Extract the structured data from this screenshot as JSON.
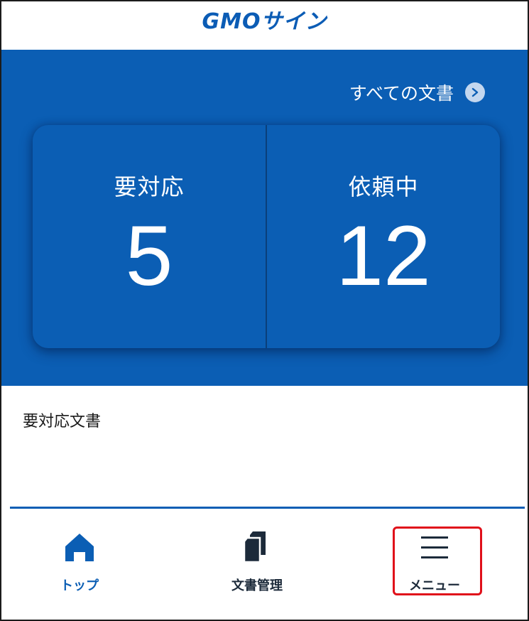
{
  "header": {
    "logo_text": "GMOサイン"
  },
  "summary": {
    "all_documents_label": "すべての文書",
    "needs_action": {
      "label": "要対応",
      "count": "5"
    },
    "requested": {
      "label": "依頼中",
      "count": "12"
    }
  },
  "section": {
    "title": "要対応文書"
  },
  "bottom_nav": {
    "items": [
      {
        "label": "トップ",
        "icon": "home-icon",
        "active": true
      },
      {
        "label": "文書管理",
        "icon": "documents-icon",
        "active": false
      },
      {
        "label": "メニュー",
        "icon": "hamburger-menu-icon",
        "active": false
      }
    ]
  },
  "colors": {
    "brand_blue": "#0b5eb4",
    "highlight_red": "#e0101a",
    "chevron_bg": "#c3d7ef"
  }
}
